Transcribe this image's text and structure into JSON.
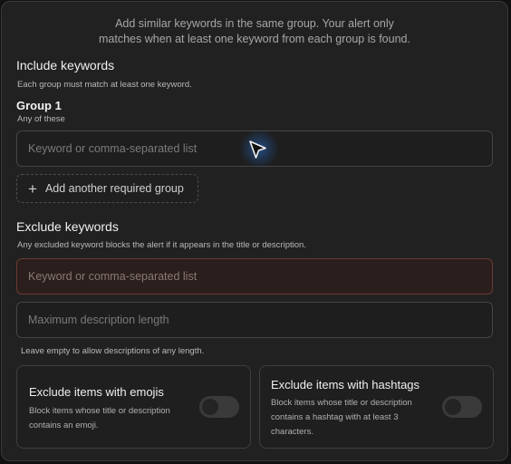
{
  "intro": {
    "line1": "Add similar keywords in the same group. Your alert only",
    "line2": "matches when at least one keyword from each group is found."
  },
  "include": {
    "title": "Include keywords",
    "subtitle": "Each group must match at least one keyword.",
    "group": {
      "title": "Group 1",
      "subtitle": "Any of these",
      "input_placeholder": "Keyword or comma-separated list",
      "input_value": ""
    },
    "add_group_label": "Add another required group"
  },
  "exclude": {
    "title": "Exclude keywords",
    "subtitle": "Any excluded keyword blocks the alert if it appears in the title or description.",
    "input_placeholder": "Keyword or comma-separated list",
    "input_value": ""
  },
  "max_length": {
    "placeholder": "Maximum description length",
    "value": "",
    "hint": "Leave empty to allow descriptions of any length."
  },
  "options": [
    {
      "title": "Exclude items with emojis",
      "desc_line1": "Block items whose title or description",
      "desc_line2": "contains an emoji.",
      "enabled": false
    },
    {
      "title": "Exclude items with hashtags",
      "desc_line1": "Block items whose title or description",
      "desc_line2": "contains a hashtag with at least 3",
      "desc_line3": "characters.",
      "enabled": false
    }
  ],
  "icons": {
    "add": "plus-icon",
    "pointer": "mouse-pointer-icon"
  },
  "colors": {
    "panel_bg": "#212121",
    "error_border": "#6a3a32",
    "cursor_glow": "#2882ff"
  }
}
